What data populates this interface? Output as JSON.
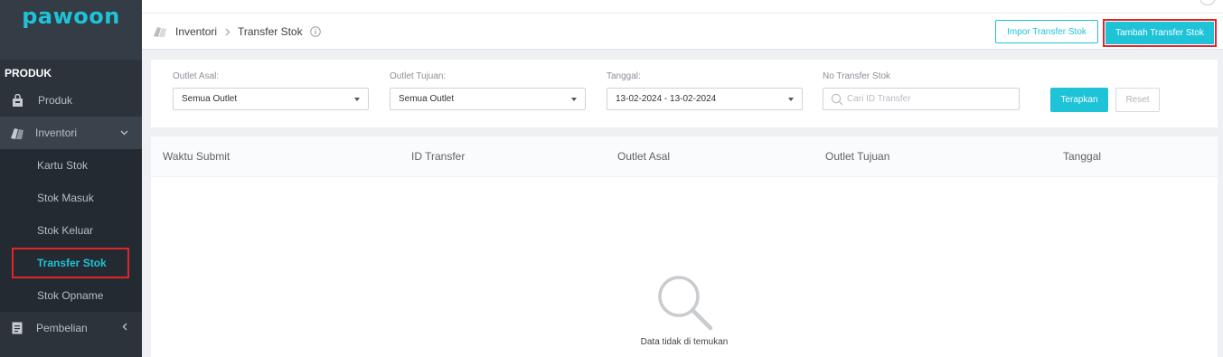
{
  "brand": {
    "logo_text": "pawoon",
    "accent": "#1ec3d8",
    "highlight": "#e0252b"
  },
  "sidebar": {
    "section_title": "PRODUK",
    "items": [
      {
        "label": "Produk",
        "icon": "bag-icon"
      },
      {
        "label": "Inventori",
        "icon": "box-icon",
        "expanded": true
      },
      {
        "label": "Pembelian",
        "icon": "document-icon",
        "expanded": false
      }
    ],
    "inventory_sub": [
      {
        "label": "Kartu Stok"
      },
      {
        "label": "Stok Masuk"
      },
      {
        "label": "Stok Keluar"
      },
      {
        "label": "Transfer Stok",
        "active": true
      },
      {
        "label": "Stok Opname"
      }
    ]
  },
  "header": {
    "breadcrumb": [
      "Inventori",
      "Transfer Stok"
    ],
    "separator": ">",
    "import_button": "Impor Transfer Stok",
    "add_button": "Tambah Transfer Stok"
  },
  "filters": {
    "outlet_asal": {
      "label": "Outlet Asal:",
      "value": "Semua Outlet"
    },
    "outlet_tujuan": {
      "label": "Outlet Tujuan:",
      "value": "Semua Outlet"
    },
    "tanggal": {
      "label": "Tanggal:",
      "value": "13-02-2024 - 13-02-2024"
    },
    "no_transfer": {
      "label": "No Transfer Stok",
      "placeholder": "Cari ID Transfer"
    },
    "apply_button": "Terapkan",
    "reset_button": "Reset"
  },
  "table": {
    "columns": [
      "Waktu Submit",
      "ID Transfer",
      "Outlet Asal",
      "Outlet Tujuan",
      "Tanggal"
    ],
    "rows": [],
    "empty_text": "Data tidak di temukan"
  }
}
